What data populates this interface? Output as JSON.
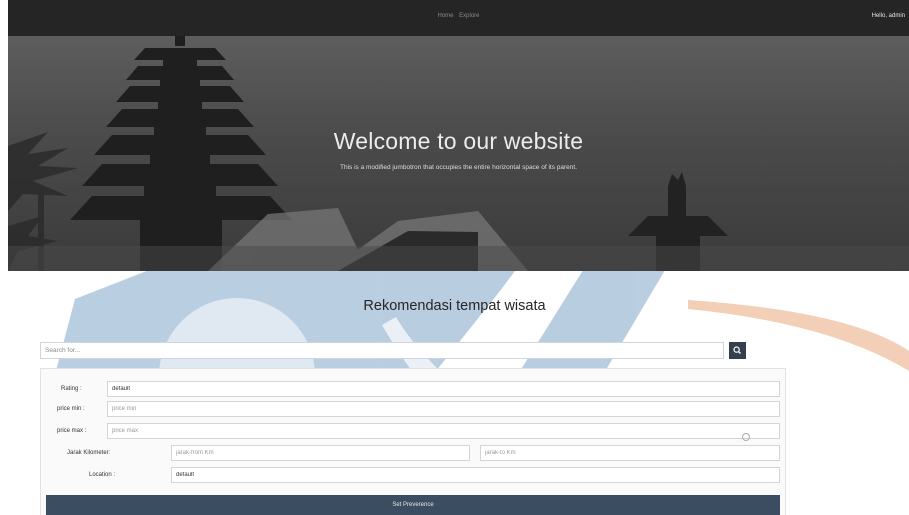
{
  "navbar": {
    "links": [
      "Home",
      "Explore"
    ],
    "user_greeting": "Hello, admin"
  },
  "jumbotron": {
    "title": "Welcome to our website",
    "subtitle": "This is a modified jumbotron that occupies the entire horizontal space of its parent."
  },
  "section": {
    "title": "Rekomendasi tempat wisata"
  },
  "search": {
    "placeholder": "Search for...",
    "button_icon": "search-icon"
  },
  "filters": {
    "rating": {
      "label": "Rating :",
      "value": "default"
    },
    "price_min": {
      "label": "price min :",
      "placeholder": "price min"
    },
    "price_max": {
      "label": "price max :",
      "placeholder": "price max"
    },
    "distance": {
      "label": "Jarak Kilometer:",
      "from_placeholder": "jarak-from Km",
      "to_placeholder": "jarak-to Km"
    },
    "location": {
      "label": "Location :",
      "value": "default"
    },
    "submit_label": "Set Preverence"
  },
  "colors": {
    "navbar_bg": "#252525",
    "button_bg": "#3b4d60",
    "watermark_blue": "#2f6aa5",
    "watermark_orange": "#e8a77a"
  }
}
